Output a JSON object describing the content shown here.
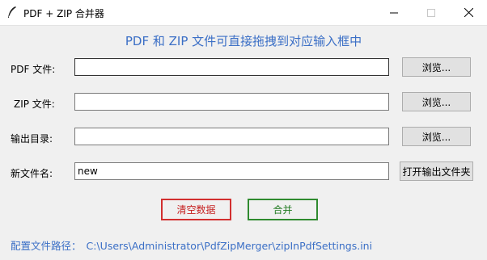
{
  "window": {
    "title": "PDF + ZIP 合并器",
    "controls": {
      "minimize": "minimize-icon",
      "maximize": "maximize-icon",
      "close": "close-icon"
    }
  },
  "heading": "PDF 和 ZIP 文件可直接拖拽到对应输入框中",
  "fields": [
    {
      "label": "PDF 文件:",
      "value": "",
      "button": "浏览..."
    },
    {
      "label": "ZIP 文件:",
      "value": "",
      "button": "浏览..."
    },
    {
      "label": "输出目录:",
      "value": "",
      "button": "浏览..."
    },
    {
      "label": "新文件名:",
      "value": "new",
      "button": "打开输出文件夹"
    }
  ],
  "actions": {
    "clear": "清空数据",
    "merge": "合并"
  },
  "config": {
    "label": "配置文件路径：",
    "path": "C:\\Users\\Administrator\\PdfZipMerger\\zipInPdfSettings.ini"
  },
  "colors": {
    "accent": "#3b6fc6",
    "clear_border": "#d22f2f",
    "merge_border": "#2f8a2f"
  }
}
